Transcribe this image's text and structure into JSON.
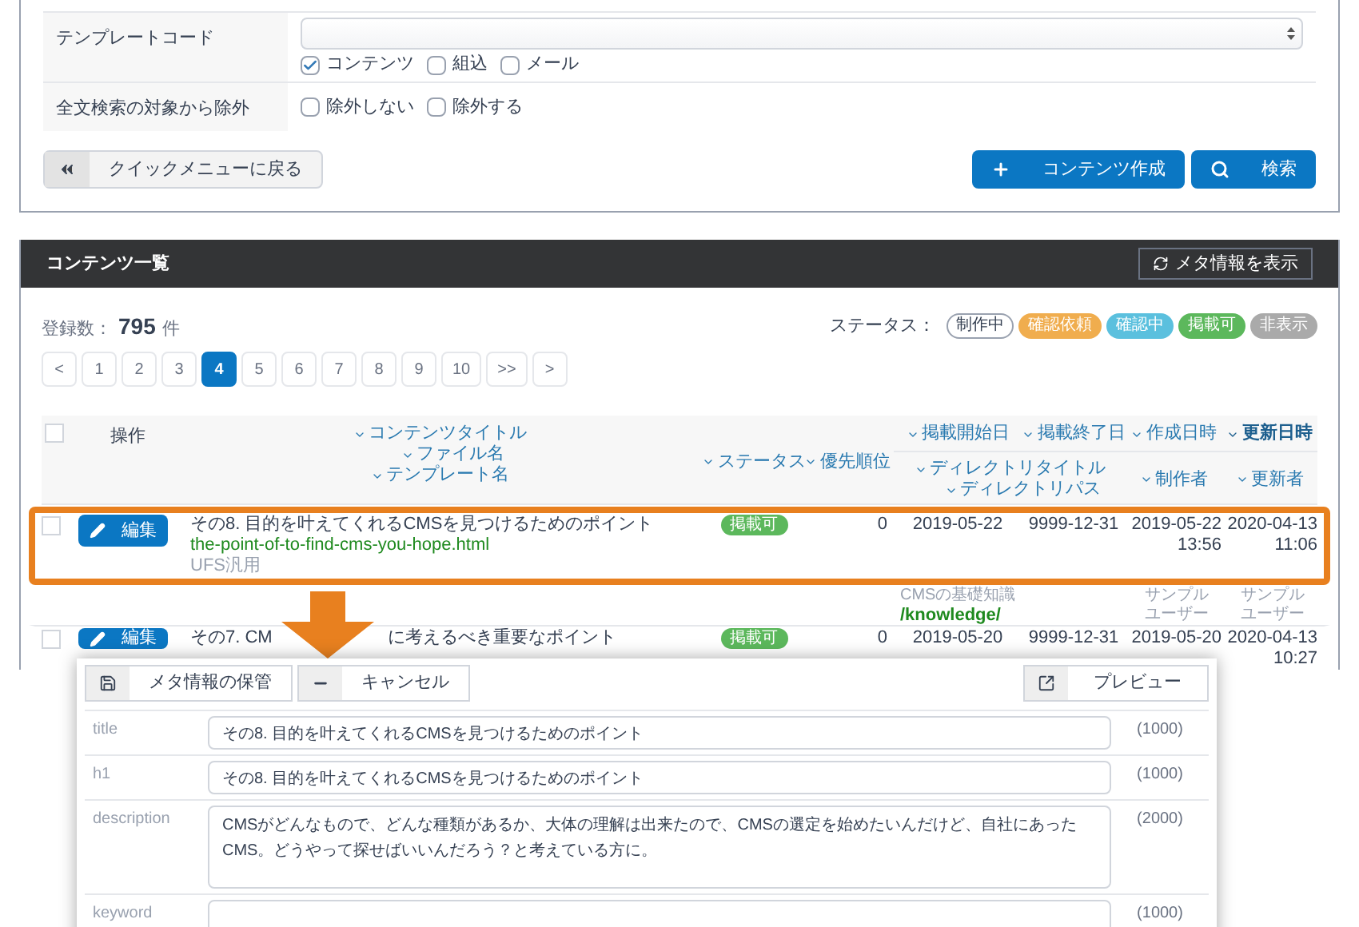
{
  "search_form": {
    "template_code": {
      "label": "テンプレートコード",
      "checkboxes": [
        {
          "label": "コンテンツ",
          "checked": true
        },
        {
          "label": "組込",
          "checked": false
        },
        {
          "label": "メール",
          "checked": false
        }
      ]
    },
    "fulltext_exclusion": {
      "label": "全文検索の対象から除外",
      "checkboxes": [
        {
          "label": "除外しない",
          "checked": false
        },
        {
          "label": "除外する",
          "checked": false
        }
      ]
    },
    "back_button": "クイックメニューに戻る",
    "create_button": "コンテンツ作成",
    "search_button": "検索"
  },
  "content_list": {
    "title": "コンテンツ一覧",
    "meta_button": "メタ情報を表示",
    "count_label": "登録数：",
    "count": "795",
    "count_unit": "件",
    "status_label": "ステータス：",
    "statuses": [
      {
        "label": "制作中",
        "color": "#ffffff"
      },
      {
        "label": "確認依頼",
        "color": "#f0ad4e"
      },
      {
        "label": "確認中",
        "color": "#5bc0de"
      },
      {
        "label": "掲載可",
        "color": "#5cb85c"
      },
      {
        "label": "非表示",
        "color": "#aaaaaa"
      }
    ],
    "pagination": [
      {
        "label": "<",
        "selected": false
      },
      {
        "label": "1",
        "selected": false
      },
      {
        "label": "2",
        "selected": false
      },
      {
        "label": "3",
        "selected": false
      },
      {
        "label": "4",
        "selected": true
      },
      {
        "label": "5",
        "selected": false
      },
      {
        "label": "6",
        "selected": false
      },
      {
        "label": "7",
        "selected": false
      },
      {
        "label": "8",
        "selected": false
      },
      {
        "label": "9",
        "selected": false
      },
      {
        "label": "10",
        "selected": false
      },
      {
        "label": ">>",
        "selected": false
      },
      {
        "label": ">",
        "selected": false
      }
    ],
    "select_all": {
      "checked": false
    },
    "columns": {
      "operation": "操作",
      "title": "コンテンツタイトル",
      "file": "ファイル名",
      "template": "テンプレート名",
      "status": "ステータス",
      "priority": "優先順位",
      "start": "掲載開始日",
      "end": "掲載終了日",
      "created": "作成日時",
      "updated": "更新日時",
      "dir_title": "ディレクトリタイトル",
      "dir_path": "ディレクトリパス",
      "creator": "制作者",
      "updater": "更新者"
    },
    "rows": [
      {
        "checked": false,
        "highlighted": true,
        "edit": "編集",
        "title_parts": [
          "その8. 目的を叶えてくれるCMSを見つけるためのポイント"
        ],
        "file": "the-point-of-to-find-cms-you-hope.html",
        "template": "UFS汎用",
        "status": "掲載可",
        "color": "#5cb85c",
        "priority": "0",
        "start": "2019-05-22",
        "end": "9999-12-31",
        "created": [
          "2019-05-22",
          "13:56"
        ],
        "updated": [
          "2020-04-13",
          "11:06"
        ],
        "dir_title": "CMSの基礎知識",
        "dir_path": "/knowledge/",
        "creator": "サンプルユーザー",
        "updater": "サンプルユーザー"
      },
      {
        "checked": false,
        "highlighted": false,
        "edit": "編集",
        "title_parts": [
          "その7. CM",
          "に考えるべき重要なポイント"
        ],
        "status": "掲載可",
        "color": "#5cb85c",
        "priority": "0",
        "start": "2019-05-20",
        "end": "9999-12-31",
        "created": [
          "2019-05-20"
        ],
        "updated": [
          "2020-04-13",
          "10:27"
        ]
      }
    ]
  },
  "meta_editor": {
    "save_button": "メタ情報の保管",
    "cancel_button": "キャンセル",
    "preview_button": "プレビュー",
    "fields": [
      {
        "kind": "line",
        "label": "title",
        "value": "その8. 目的を叶えてくれるCMSを見つけるためのポイント",
        "limit": "(1000)"
      },
      {
        "kind": "line",
        "label": "h1",
        "value": "その8. 目的を叶えてくれるCMSを見つけるためのポイント",
        "limit": "(1000)"
      },
      {
        "kind": "area",
        "label": "description",
        "value": "CMSがどんなもので、どんな種類があるか、大体の理解は出来たので、CMSの選定を始めたいんだけど、自社にあったCMS。どうやって探せばいいんだろう？と考えている方に。",
        "limit": "(2000)"
      },
      {
        "kind": "line",
        "label": "keyword",
        "limit": "(1000)"
      }
    ]
  }
}
